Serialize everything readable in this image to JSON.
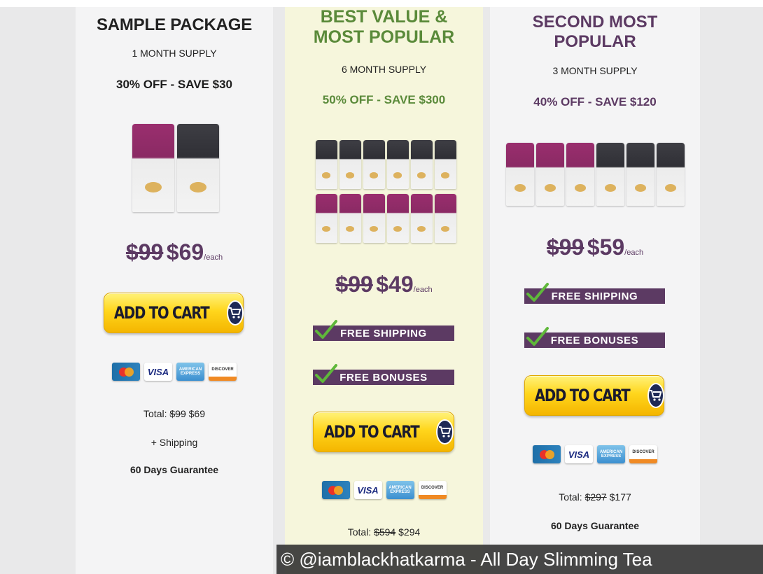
{
  "packages": {
    "sample": {
      "title": "SAMPLE PACKAGE",
      "supply": "1 MONTH SUPPLY",
      "discount": "30% OFF - SAVE $30",
      "old_price": "$99",
      "new_price": "$69",
      "per": "/each",
      "cart_label": "ADD TO CART",
      "total_label": "Total:",
      "total_old": "$99",
      "total_new": "$69",
      "shipping_note": "+ Shipping",
      "guarantee": "60 Days Guarantee"
    },
    "best": {
      "title_line1": "BEST VALUE &",
      "title_line2": "MOST POPULAR",
      "supply": "6 MONTH SUPPLY",
      "discount": "50% OFF - SAVE $300",
      "old_price": "$99",
      "new_price": "$49",
      "per": "/each",
      "free_shipping": "FREE SHIPPING",
      "free_bonuses": "FREE BONUSES",
      "cart_label": "ADD TO CART",
      "total_label": "Total:",
      "total_old": "$594",
      "total_new": "$294"
    },
    "second": {
      "title_line1": "SECOND MOST",
      "title_line2": "POPULAR",
      "supply": "3 MONTH SUPPLY",
      "discount": "40% OFF - SAVE $120",
      "old_price": "$99",
      "new_price": "$59",
      "per": "/each",
      "free_shipping": "FREE SHIPPING",
      "free_bonuses": "FREE BONUSES",
      "cart_label": "ADD TO CART",
      "total_label": "Total:",
      "total_old": "$297",
      "total_new": "$177",
      "guarantee": "60 Days Guarantee"
    }
  },
  "payment_cards": {
    "mastercard": "MasterCard",
    "visa": "VISA",
    "amex": "AMERICAN EXPRESS",
    "discover": "DISCOVER"
  },
  "icons": {
    "cart": "shopping-cart-icon",
    "check": "checkmark-icon"
  },
  "colors": {
    "plum": "#5c3a63",
    "green": "#5a8a3a",
    "cart_yellow": "#ffd61c",
    "best_bg": "#f6f6dc"
  },
  "watermark": "© @iamblackhatkarma - All Day Slimming Tea"
}
